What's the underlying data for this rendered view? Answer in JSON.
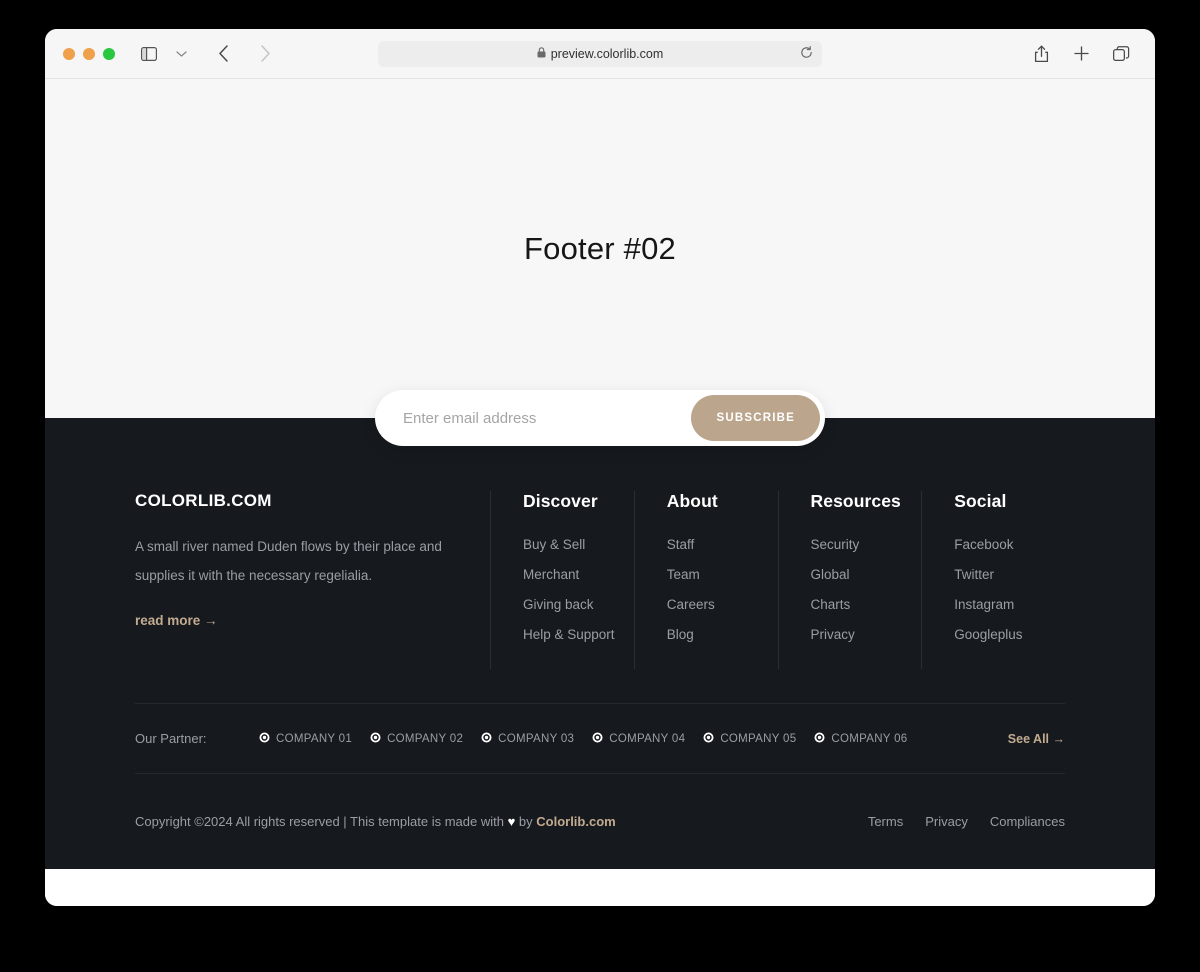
{
  "browser": {
    "url": "preview.colorlib.com",
    "icons": {
      "lock": "lock-icon",
      "reload": "reload-icon",
      "sidebar": "sidebar-toggle-icon",
      "chevron_down": "chevron-down-icon",
      "back": "back-arrow-icon",
      "forward": "forward-arrow-icon",
      "share": "share-icon",
      "new_tab": "plus-icon",
      "tabs": "tab-overview-icon"
    }
  },
  "hero": {
    "title": "Footer #02"
  },
  "subscribe": {
    "placeholder": "Enter email address",
    "value": "",
    "button_label": "SUBSCRIBE"
  },
  "brand": {
    "name": "COLORLIB.COM",
    "description": "A small river named Duden flows by their place and supplies it with the necessary regelialia.",
    "read_more": "read more →"
  },
  "columns": [
    {
      "title": "Discover",
      "links": [
        "Buy & Sell",
        "Merchant",
        "Giving back",
        "Help & Support"
      ]
    },
    {
      "title": "About",
      "links": [
        "Staff",
        "Team",
        "Careers",
        "Blog"
      ]
    },
    {
      "title": "Resources",
      "links": [
        "Security",
        "Global",
        "Charts",
        "Privacy"
      ]
    },
    {
      "title": "Social",
      "links": [
        "Facebook",
        "Twitter",
        "Instagram",
        "Googleplus"
      ]
    }
  ],
  "partners": {
    "label": "Our Partner:",
    "items": [
      "COMPANY 01",
      "COMPANY 02",
      "COMPANY 03",
      "COMPANY 04",
      "COMPANY 05",
      "COMPANY 06"
    ],
    "see_all": "See All →"
  },
  "copyright": {
    "prefix": "Copyright ©2024 All rights reserved | This template is made with ",
    "heart": "♥",
    "middle": " by ",
    "brand": "Colorlib.com"
  },
  "legal": [
    "Terms",
    "Privacy",
    "Compliances"
  ],
  "colors": {
    "accent": "#bba68d",
    "footer_bg": "#16191d",
    "hero_bg": "#f7f7f7",
    "muted_text": "#9a9fa5"
  }
}
